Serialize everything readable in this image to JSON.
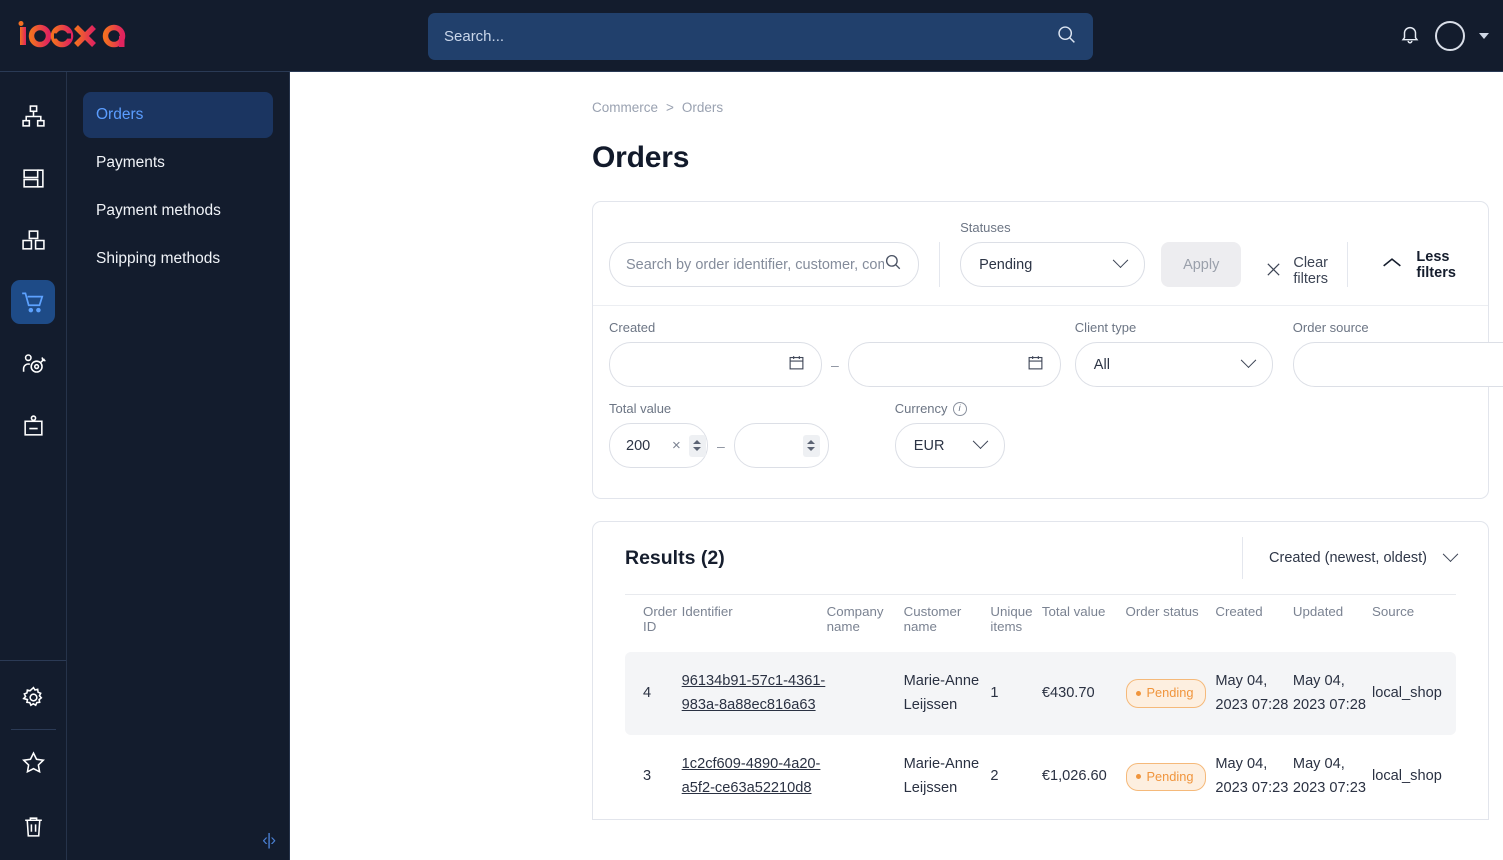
{
  "brand": {
    "name": "ibexa",
    "colors": {
      "orange": "#f25c27",
      "crimson": "#d92b54"
    }
  },
  "topbar": {
    "search_placeholder": "Search...",
    "search_value": "",
    "search_icon": "search-icon",
    "notifications_icon": "bell-icon",
    "avatar_label": ""
  },
  "rail": {
    "items": [
      {
        "icon": "sitemap-icon",
        "name": "content-structure"
      },
      {
        "icon": "layouts-icon",
        "name": "site-layouts"
      },
      {
        "icon": "products-icon",
        "name": "products"
      },
      {
        "icon": "cart-icon",
        "name": "commerce",
        "active": true
      },
      {
        "icon": "customer-target-icon",
        "name": "customer-personalization"
      },
      {
        "icon": "content-item-icon",
        "name": "content-items"
      }
    ],
    "bottom": [
      {
        "icon": "gear-icon",
        "name": "settings"
      },
      {
        "icon": "star-icon",
        "name": "bookmarks"
      },
      {
        "icon": "trash-icon",
        "name": "trash"
      }
    ]
  },
  "subnav": {
    "collapse_glyph": "‹|›",
    "items": [
      {
        "label": "Orders",
        "active": true
      },
      {
        "label": "Payments",
        "active": false
      },
      {
        "label": "Payment methods",
        "active": false
      },
      {
        "label": "Shipping methods",
        "active": false
      }
    ]
  },
  "breadcrumb": {
    "items": [
      "Commerce",
      "Orders"
    ],
    "separator": ">"
  },
  "page": {
    "title": "Orders"
  },
  "filters": {
    "search": {
      "placeholder": "Search by order identifier, customer, company",
      "value": "",
      "icon": "search-icon"
    },
    "statuses": {
      "label": "Statuses",
      "value": "Pending"
    },
    "apply_label": "Apply",
    "clear_label": "Clear filters",
    "clear_icon": "close-icon",
    "toggle_label": "Less filters",
    "toggle_icon": "chevron-up-icon",
    "created": {
      "label": "Created",
      "from": "",
      "to": "",
      "icon": "calendar-icon",
      "dash": "–"
    },
    "client_type": {
      "label": "Client type",
      "value": "All"
    },
    "order_source": {
      "label": "Order source",
      "value": "",
      "placeholder": ""
    },
    "total_value": {
      "label": "Total value",
      "from": "200",
      "to": "",
      "dash": "–",
      "clear_glyph": "×"
    },
    "currency": {
      "label": "Currency",
      "value": "EUR",
      "info_glyph": "i"
    }
  },
  "results": {
    "title": "Results (2)",
    "sort": {
      "value": "Created (newest, oldest)"
    },
    "columns": [
      "Order ID",
      "Identifier",
      "Company name",
      "Customer name",
      "Unique items",
      "Total value",
      "Order status",
      "Created",
      "Updated",
      "Source"
    ],
    "rows": [
      {
        "order_id": "4",
        "identifier": "96134b91-57c1-4361-983a-8a88ec816a63",
        "company_name": "",
        "customer_name": "Marie-Anne Leijssen",
        "unique_items": "1",
        "total_value": "€430.70",
        "order_status": "Pending",
        "created": "May 04, 2023 07:28",
        "updated": "May 04, 2023 07:28",
        "source": "local_shop"
      },
      {
        "order_id": "3",
        "identifier": "1c2cf609-4890-4a20-a5f2-ce63a52210d8",
        "company_name": "",
        "customer_name": "Marie-Anne Leijssen",
        "unique_items": "2",
        "total_value": "€1,026.60",
        "order_status": "Pending",
        "created": "May 04, 2023 07:23",
        "updated": "May 04, 2023 07:23",
        "source": "local_shop"
      }
    ]
  },
  "colors": {
    "nav_bg": "#131c2d",
    "accent_blue": "#1e4b87",
    "status_pending_text": "#f0953d",
    "status_pending_bg": "#fdefe0"
  }
}
